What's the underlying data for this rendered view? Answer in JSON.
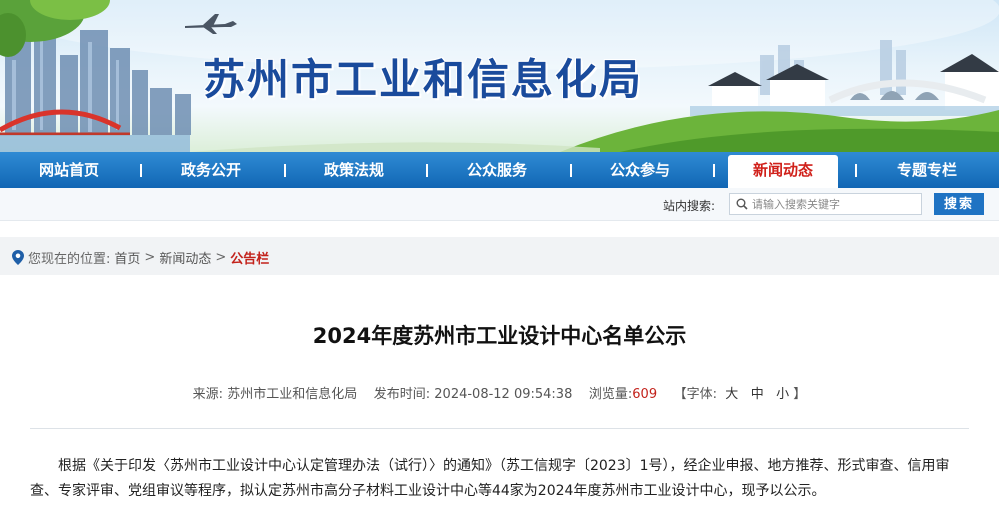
{
  "site": {
    "title": "苏州市工业和信息化局"
  },
  "nav": {
    "items": [
      {
        "label": "网站首页"
      },
      {
        "label": "政务公开"
      },
      {
        "label": "政策法规"
      },
      {
        "label": "公众服务"
      },
      {
        "label": "公众参与"
      },
      {
        "label": "新闻动态",
        "active": true
      },
      {
        "label": "专题专栏"
      }
    ],
    "separator": "|"
  },
  "search": {
    "label": "站内搜索:",
    "placeholder": "请输入搜索关键字",
    "button": "搜索"
  },
  "breadcrumb": {
    "prefix": "您现在的位置:",
    "items": [
      "首页",
      "新闻动态",
      "公告栏"
    ],
    "sep": ">"
  },
  "article": {
    "title": "2024年度苏州市工业设计中心名单公示",
    "source_label": "来源:",
    "source": "苏州市工业和信息化局",
    "time_label": "发布时间:",
    "time": "2024-08-12 09:54:38",
    "views_label": "浏览量:",
    "views": "609",
    "font_label_open": "【字体:",
    "font_large": "大",
    "font_medium": "中",
    "font_small": "小",
    "font_label_close": "】",
    "body": "根据《关于印发〈苏州市工业设计中心认定管理办法（试行）〉的通知》（苏工信规字〔2023〕1号），经企业申报、地方推荐、形式审查、信用审查、专家评审、党组审议等程序，拟认定苏州市高分子材料工业设计中心等44家为2024年度苏州市工业设计中心，现予以公示。"
  },
  "colors": {
    "nav_blue": "#1a74c2",
    "active_red": "#d0201a",
    "title_blue": "#1a4b9c"
  }
}
